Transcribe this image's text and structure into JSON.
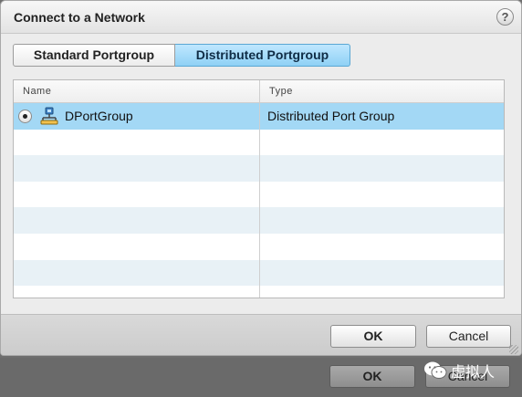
{
  "dialog": {
    "title": "Connect to a Network",
    "help_label": "?"
  },
  "tabs": [
    {
      "label": "Standard Portgroup",
      "active": false
    },
    {
      "label": "Distributed Portgroup",
      "active": true
    }
  ],
  "table": {
    "columns": [
      "Name",
      "Type"
    ],
    "rows": [
      {
        "name": "DPortGroup",
        "type": "Distributed Port Group",
        "selected": true,
        "icon": "distributed-portgroup-icon"
      }
    ]
  },
  "footer": {
    "ok_label": "OK",
    "cancel_label": "Cancel"
  },
  "background_dialog": {
    "ok_label": "OK",
    "cancel_label": "Cancel"
  },
  "watermark": {
    "text": "虚拟人",
    "icon": "wechat-icon"
  },
  "colors": {
    "selected_row": "#a3d8f5",
    "active_tab": "#8fd1f5"
  }
}
